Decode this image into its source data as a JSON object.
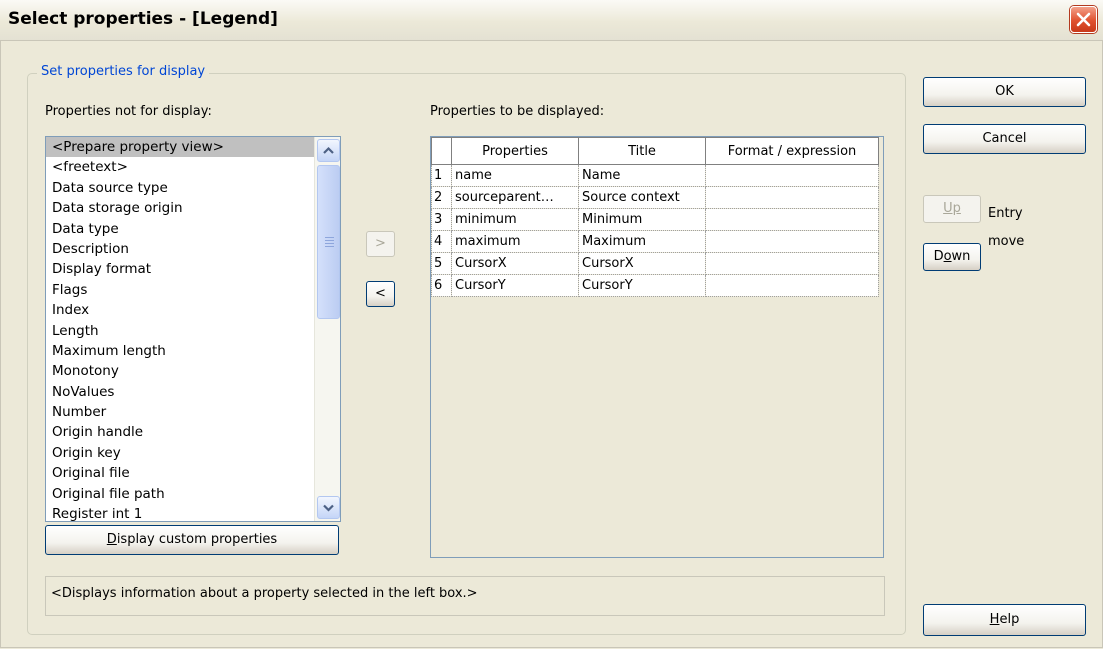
{
  "window": {
    "title": "Select properties - [Legend]"
  },
  "group": {
    "label": "Set properties for display"
  },
  "left_list": {
    "label": "Properties not for display:",
    "items": [
      "<Prepare property view>",
      "<freetext>",
      "Data source type",
      "Data storage origin",
      "Data type",
      "Description",
      "Display format",
      "Flags",
      "Index",
      "Length",
      "Maximum length",
      "Monotony",
      "NoValues",
      "Number",
      "Origin handle",
      "Origin key",
      "Original file",
      "Original file path",
      "Register int 1"
    ],
    "selected_index": 0
  },
  "buttons": {
    "add": ">",
    "remove": "<",
    "custom_prefix": "D",
    "custom_rest": "isplay custom properties",
    "ok": "OK",
    "cancel": "Cancel",
    "up": "Up",
    "down_prefix": "D",
    "down_mnemonic": "o",
    "down_rest": "wn",
    "help_mnemonic": "H",
    "help_rest": "elp"
  },
  "entry_move": {
    "line1": "Entry",
    "line2": "move"
  },
  "right_table": {
    "label": "Properties to be displayed:",
    "headers": [
      "Properties",
      "Title",
      "Format / expression"
    ],
    "rows": [
      {
        "n": "1",
        "property": "name",
        "title": "Name",
        "format": ""
      },
      {
        "n": "2",
        "property": "sourceparent…",
        "title": "Source context",
        "format": ""
      },
      {
        "n": "3",
        "property": "minimum",
        "title": "Minimum",
        "format": ""
      },
      {
        "n": "4",
        "property": "maximum",
        "title": "Maximum",
        "format": ""
      },
      {
        "n": "5",
        "property": "CursorX",
        "title": "CursorX",
        "format": ""
      },
      {
        "n": "6",
        "property": "CursorY",
        "title": "CursorY",
        "format": ""
      }
    ]
  },
  "info_box": {
    "text": "<Displays information about a property selected in the left box.>"
  },
  "colors": {
    "dialog_bg": "#ece9d8",
    "group_label": "#0046d5",
    "selection": "#c0c0c0",
    "close_button": "#e0512f"
  }
}
